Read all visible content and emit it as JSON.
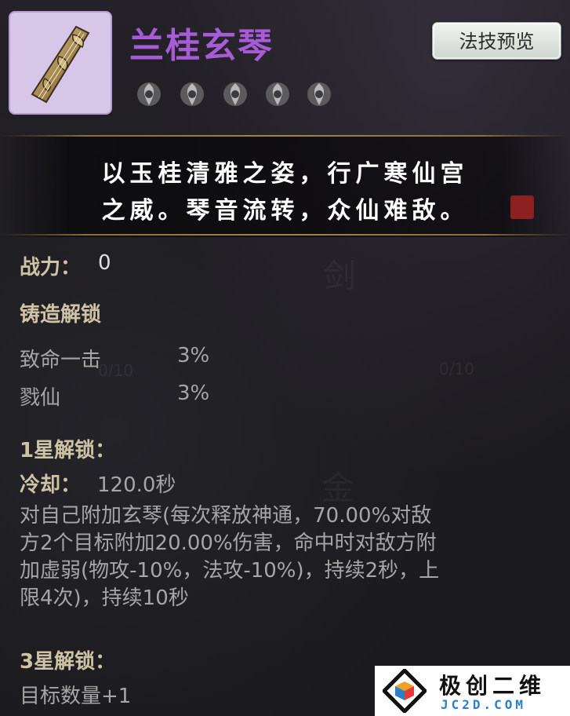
{
  "item": {
    "name": "兰桂玄琴",
    "icon": "jade-qin-icon",
    "stars": [
      {
        "icon": "star-slot-icon"
      },
      {
        "icon": "star-slot-icon"
      },
      {
        "icon": "star-slot-icon"
      },
      {
        "icon": "star-slot-icon"
      },
      {
        "icon": "star-slot-icon"
      }
    ]
  },
  "header": {
    "preview_button_label": "法技预览"
  },
  "description": {
    "line1": "以玉桂清雅之姿，行广寒仙宫",
    "line2": "之威。琴音流转，众仙难敌。"
  },
  "stats": {
    "power_label": "战力：",
    "power_value": "0"
  },
  "forge_unlock": {
    "title": "铸造解锁",
    "rows": [
      {
        "name": "致命一击",
        "value": "3%"
      },
      {
        "name": "戮仙",
        "value": "3%"
      }
    ]
  },
  "star1_unlock": {
    "title": "1星解锁：",
    "cooldown_label": "冷却：",
    "cooldown_value": "120.0秒",
    "effect_line1": "对自己附加玄琴(每次释放神通，70.00%对敌",
    "effect_line2": "方2个目标附加20.00%伤害，命中时对敌方附",
    "effect_line3": "加虚弱(物攻-10%，法攻-10%)，持续2秒，上",
    "effect_line4": "限4次)，持续10秒"
  },
  "star3_unlock": {
    "title": "3星解锁：",
    "effect": "目标数量+1"
  },
  "background_hints": {
    "glyph1": "剑",
    "glyph2": "金",
    "count_left": "0/10",
    "count_right": "0/10"
  },
  "watermark": {
    "title": "极创二维",
    "url": "JC2D.COM"
  },
  "colors": {
    "name_purple": "#a85bd6",
    "gold_label": "#cfc3a6",
    "text_grey": "#a6a6a6",
    "seal_red": "#8c1f1f"
  }
}
